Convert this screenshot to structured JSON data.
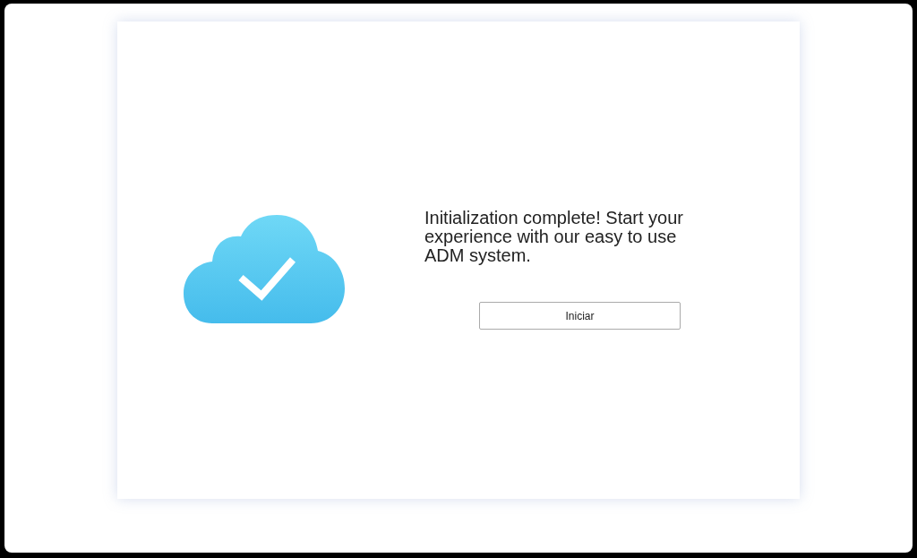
{
  "message": "Initialization complete! Start your experience with our easy to use ADM system.",
  "button": {
    "label": "Iniciar"
  }
}
